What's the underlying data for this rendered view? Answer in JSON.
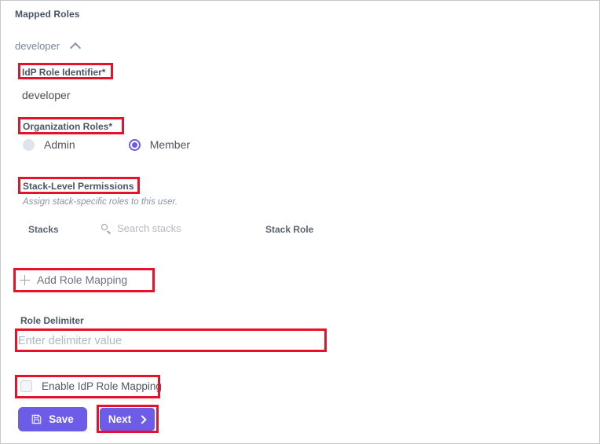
{
  "panel": {
    "title": "Mapped Roles",
    "border_color": "#c8c8c8",
    "annotation_color": "#e8112a",
    "accent_color": "#6c5ce7"
  },
  "role_group": {
    "name": "developer",
    "collapse_icon": "chevron-up-icon"
  },
  "idp_role_identifier": {
    "label": "IdP Role Identifier*",
    "value": "developer"
  },
  "organization_roles": {
    "label": "Organization Roles*",
    "options": [
      {
        "label": "Admin",
        "selected": false
      },
      {
        "label": "Member",
        "selected": true
      }
    ]
  },
  "stack_level_permissions": {
    "label": "Stack-Level Permissions",
    "helper": "Assign stack-specific roles to this user.",
    "columns": {
      "stacks": "Stacks",
      "stack_role": "Stack Role"
    },
    "search": {
      "placeholder": "Search stacks",
      "value": "",
      "icon": "search-icon"
    },
    "rows": []
  },
  "add_role_mapping": {
    "label": "Add Role Mapping",
    "icon": "plus-icon"
  },
  "role_delimiter": {
    "label": "Role Delimiter",
    "placeholder": "Enter delimiter value",
    "value": ""
  },
  "enable_idp_role_mapping": {
    "label": "Enable IdP Role Mapping",
    "checked": false
  },
  "actions": {
    "save": {
      "label": "Save",
      "icon": "save-disk-icon"
    },
    "next": {
      "label": "Next",
      "icon": "chevron-right-icon"
    }
  }
}
